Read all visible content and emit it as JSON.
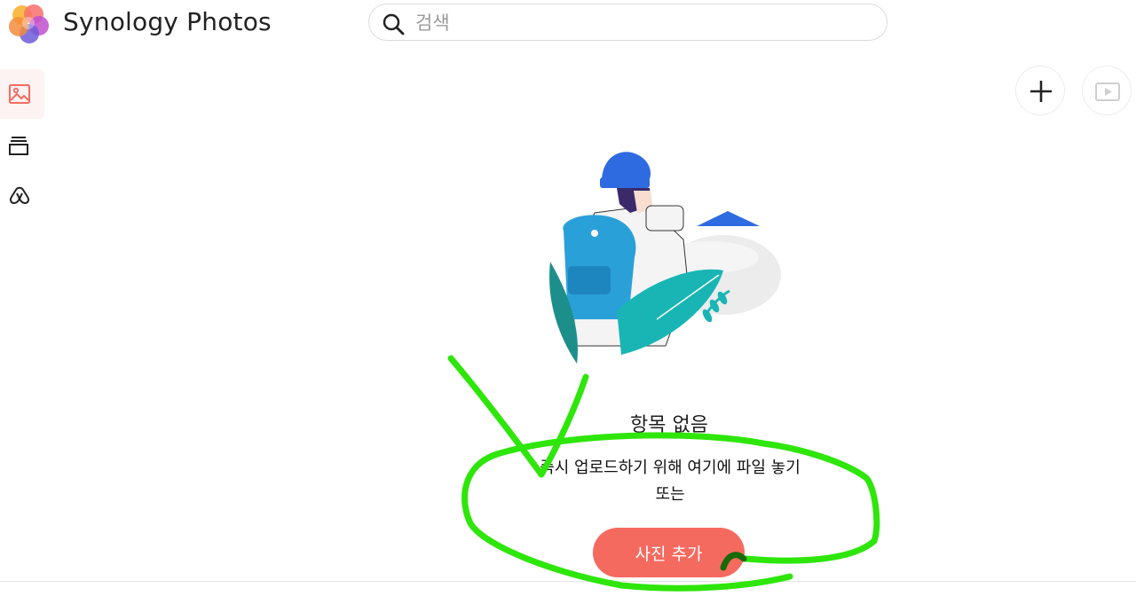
{
  "app": {
    "title": "Synology Photos",
    "logo_icon": "synology-photos-logo"
  },
  "search": {
    "placeholder": "검색",
    "value": "",
    "icon": "search-icon"
  },
  "sidebar": {
    "items": [
      {
        "icon": "photo-icon",
        "active": true
      },
      {
        "icon": "albums-icon",
        "active": false
      },
      {
        "icon": "shared-space-icon",
        "active": false
      }
    ]
  },
  "toolbar": {
    "add_icon": "plus-icon",
    "slideshow_icon": "slideshow-icon"
  },
  "empty_state": {
    "title": "항목 없음",
    "description": "즉시 업로드하기 위해 여기에 파일 놓기",
    "or_text": "또는",
    "add_button_label": "사진 추가"
  },
  "colors": {
    "accent": "#f56a5f",
    "active_nav_bg": "#fdf3f2",
    "annotation_green": "#2ee60a"
  }
}
